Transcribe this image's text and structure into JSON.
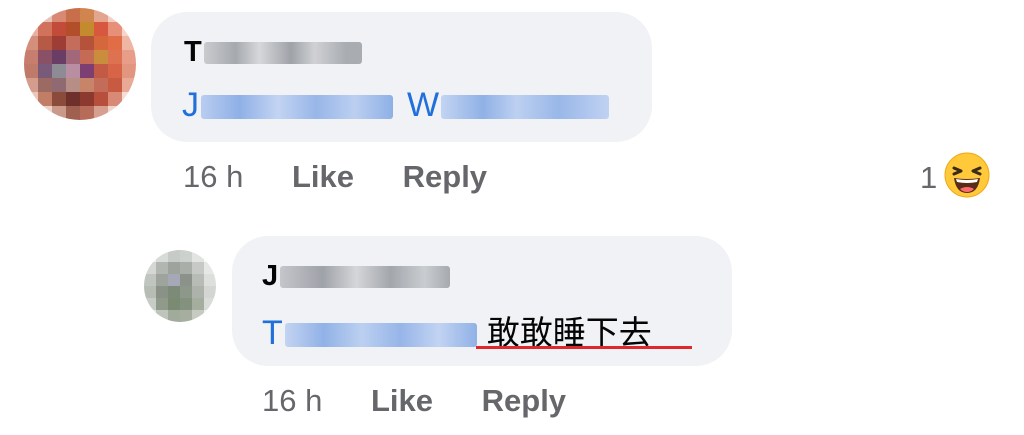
{
  "comments": [
    {
      "author_visible": "T",
      "mention_prefix": "J",
      "mention_mid": "W",
      "time": "16 h",
      "like_label": "Like",
      "reply_label": "Reply",
      "reaction_count": "1",
      "reaction_icon": "laughing-emoji-icon"
    },
    {
      "author_visible": "J",
      "mention_prefix": "T",
      "text": "敢敢睡下去",
      "time": "16 h",
      "like_label": "Like",
      "reply_label": "Reply"
    }
  ],
  "colors": {
    "bubble": "#f0f2f5",
    "mention_link": "#216fdb",
    "meta_text": "#65676b",
    "spellcheck_underline": "#e0272b",
    "emoji_face": "#ffc93a"
  }
}
